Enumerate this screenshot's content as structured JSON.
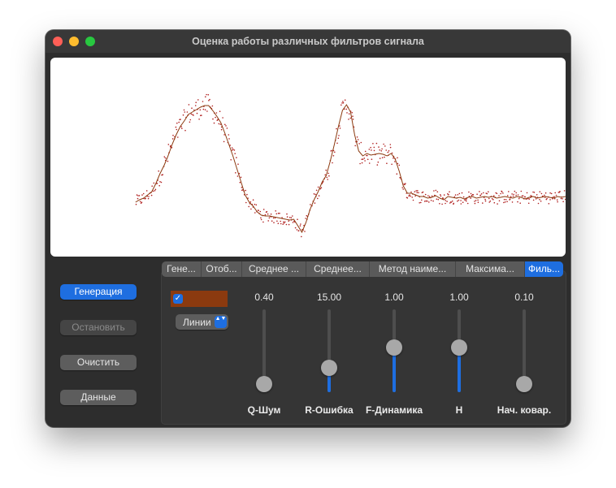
{
  "window": {
    "title": "Оценка работы различных фильтров сигнала"
  },
  "colors": {
    "accent": "#1e6ee0",
    "signal_line": "#8b3a0f",
    "noise_points": "#b02020",
    "series_color": "#8b3a0f"
  },
  "chart_data": {
    "type": "line",
    "title": "",
    "grid": false,
    "x": [
      0,
      5,
      10,
      15,
      20,
      25,
      30,
      35,
      40,
      45,
      50,
      55,
      60,
      65,
      70,
      75,
      80,
      85,
      90,
      95,
      100,
      105,
      110,
      115,
      120,
      125,
      130,
      135,
      140,
      145,
      150,
      155,
      160,
      165,
      170,
      175,
      180,
      185,
      190,
      195,
      200,
      205,
      210,
      215,
      220,
      225,
      230,
      235,
      240,
      245,
      250,
      255,
      260,
      265,
      270,
      275,
      280,
      285,
      290,
      295,
      300,
      305,
      310,
      315,
      320,
      325,
      330,
      335,
      340,
      345,
      350,
      355,
      360,
      365,
      370,
      375,
      380,
      385,
      390,
      395,
      400,
      405,
      410,
      415,
      420,
      425,
      430,
      435,
      440,
      445,
      450,
      455,
      460,
      465,
      470,
      475,
      480,
      485,
      490,
      495,
      500,
      505,
      510,
      515,
      520,
      525,
      530
    ],
    "xlim": [
      -105,
      530
    ],
    "ylim": [
      0,
      245
    ],
    "series": [
      {
        "values": [
          67,
          70,
          72,
          76,
          80,
          90,
          102,
          112,
          124,
          138,
          150,
          160,
          167,
          175,
          178,
          181,
          184,
          186,
          186,
          180,
          173,
          165,
          152,
          138,
          124,
          108,
          92,
          76,
          67,
          62,
          55,
          51,
          50,
          50,
          49,
          48,
          47,
          46,
          45,
          46,
          38,
          30,
          42,
          58,
          70,
          80,
          92,
          100,
          118,
          138,
          160,
          180,
          187,
          178,
          150,
          130,
          124,
          127,
          125,
          126,
          127,
          126,
          124,
          127,
          120,
          105,
          87,
          78,
          78,
          76,
          74,
          74,
          72,
          73,
          75,
          72,
          70,
          74,
          73,
          72,
          73,
          71,
          73,
          74,
          72,
          73,
          74,
          73,
          74,
          72,
          73,
          74,
          73,
          72,
          74,
          73,
          71,
          73,
          74,
          72,
          73,
          74,
          73,
          72,
          74,
          73,
          74
        ]
      }
    ]
  },
  "left_buttons": [
    {
      "label": "Генерация"
    },
    {
      "label": "Остановить"
    },
    {
      "label": "Очистить"
    },
    {
      "label": "Данные"
    }
  ],
  "tabs": [
    {
      "label": "Гене..."
    },
    {
      "label": "Отоб..."
    },
    {
      "label": "Среднее ..."
    },
    {
      "label": "Среднее..."
    },
    {
      "label": "Метод наиме..."
    },
    {
      "label": "Максима..."
    },
    {
      "label": "Филь..."
    }
  ],
  "filter_panel": {
    "checkbox_checked": true,
    "checkbox_glyph": "✓",
    "line_style_select": "Линии",
    "select_arrows_glyph": "▲▼",
    "sliders": [
      {
        "label": "Q-Шум",
        "value_text": "0.40",
        "fraction": 0.0
      },
      {
        "label": "R-Ошибка",
        "value_text": "15.00",
        "fraction": 0.25
      },
      {
        "label": "F-Динамика",
        "value_text": "1.00",
        "fraction": 0.55
      },
      {
        "label": "H",
        "value_text": "1.00",
        "fraction": 0.55
      },
      {
        "label": "Нач. ковар.",
        "value_text": "0.10",
        "fraction": 0.0
      }
    ]
  }
}
